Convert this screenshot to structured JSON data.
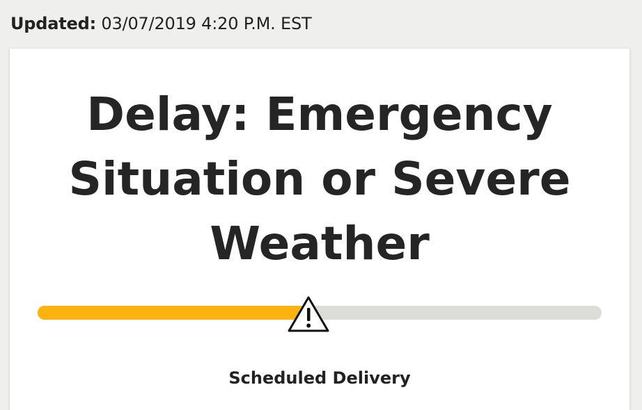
{
  "updated": {
    "label": "Updated:",
    "value": "03/07/2019 4:20 P.M. EST"
  },
  "status": {
    "title": "Delay: Emergency Situation or Severe Weather",
    "progress_fraction": 0.48
  },
  "icons": {
    "marker": "warning-icon"
  },
  "colors": {
    "progress_fill": "#fbb40f",
    "progress_track": "#dcdcd8"
  },
  "delivery": {
    "heading": "Scheduled Delivery"
  }
}
